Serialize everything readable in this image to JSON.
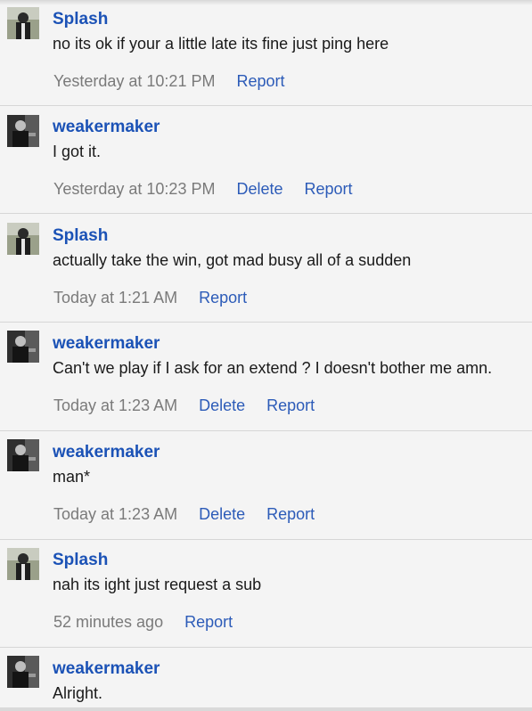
{
  "messages": [
    {
      "author": "Splash",
      "avatar": "splash-avatar",
      "text": "no its ok if your a little late its fine just ping here",
      "time": "Yesterday at 10:21 PM",
      "actions": [
        "Report"
      ]
    },
    {
      "author": "weakermaker",
      "avatar": "weakermaker-avatar",
      "text": "I got it.",
      "time": "Yesterday at 10:23 PM",
      "actions": [
        "Delete",
        "Report"
      ]
    },
    {
      "author": "Splash",
      "avatar": "splash-avatar",
      "text": "actually take the win, got mad busy all of a sudden",
      "time": "Today at 1:21 AM",
      "actions": [
        "Report"
      ]
    },
    {
      "author": "weakermaker",
      "avatar": "weakermaker-avatar",
      "text": "Can't we play if I ask for an extend ? I doesn't bother me amn.",
      "time": "Today at 1:23 AM",
      "actions": [
        "Delete",
        "Report"
      ]
    },
    {
      "author": "weakermaker",
      "avatar": "weakermaker-avatar",
      "text": "man*",
      "time": "Today at 1:23 AM",
      "actions": [
        "Delete",
        "Report"
      ]
    },
    {
      "author": "Splash",
      "avatar": "splash-avatar",
      "text": "nah its ight just request a sub",
      "time": "52 minutes ago",
      "actions": [
        "Report"
      ]
    },
    {
      "author": "weakermaker",
      "avatar": "weakermaker-avatar",
      "text": "Alright.",
      "time": "",
      "actions": []
    }
  ],
  "colors": {
    "author": "#1b52b6",
    "link": "#2c5bb8",
    "timestamp": "#7a7a7a",
    "background": "#f4f4f4"
  }
}
